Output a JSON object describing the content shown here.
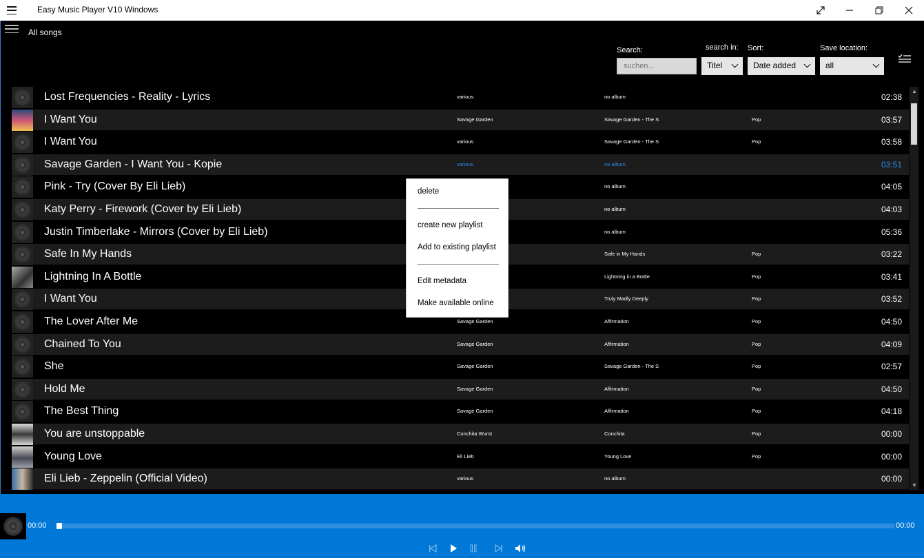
{
  "window": {
    "title": "Easy Music Player V10 Windows"
  },
  "nav": {
    "title": "All songs"
  },
  "filters": {
    "search_label": "Search:",
    "search_placeholder": "suchen...",
    "search_in_label": "search in:",
    "search_in_value": "Titel",
    "sort_label": "Sort:",
    "sort_value": "Date added",
    "save_location_label": "Save location:",
    "save_location_value": "all"
  },
  "songs": [
    {
      "title": "Lost Frequencies  - Reality - Lyrics",
      "artist": "various",
      "album": "no album",
      "genre": "",
      "duration": "02:38",
      "art": "disc"
    },
    {
      "title": "I Want You",
      "artist": "Savage Garden",
      "album": "Savage Garden - The S",
      "genre": "Pop",
      "duration": "03:57",
      "art": "art1"
    },
    {
      "title": "I Want You",
      "artist": "various",
      "album": "Savage Garden - The S",
      "genre": "Pop",
      "duration": "03:58",
      "art": "disc"
    },
    {
      "title": "Savage Garden - I Want You - Kopie",
      "artist": "various",
      "album": "no album",
      "genre": "",
      "duration": "03:51",
      "art": "disc",
      "highlighted": true
    },
    {
      "title": "Pink - Try (Cover By Eli Lieb)",
      "artist": "",
      "album": "no album",
      "genre": "",
      "duration": "04:05",
      "art": "disc"
    },
    {
      "title": "Katy Perry - Firework (Cover by Eli Lieb)",
      "artist": "",
      "album": "no album",
      "genre": "",
      "duration": "04:03",
      "art": "disc"
    },
    {
      "title": "Justin Timberlake - Mirrors (Cover by Eli Lieb)",
      "artist": "",
      "album": "no album",
      "genre": "",
      "duration": "05:36",
      "art": "disc"
    },
    {
      "title": "Safe In My Hands",
      "artist": "",
      "album": "Safe in My Hands",
      "genre": "Pop",
      "duration": "03:22",
      "art": "disc"
    },
    {
      "title": "Lightning In A Bottle",
      "artist": "",
      "album": "Lightning in a Bottle",
      "genre": "Pop",
      "duration": "03:41",
      "art": "art2"
    },
    {
      "title": "I Want You",
      "artist": "",
      "album": "Truly Madly Deeply",
      "genre": "Pop",
      "duration": "03:52",
      "art": "disc"
    },
    {
      "title": "The Lover After Me",
      "artist": "Savage Garden",
      "album": "Affirmation",
      "genre": "Pop",
      "duration": "04:50",
      "art": "disc"
    },
    {
      "title": "Chained To You",
      "artist": "Savage Garden",
      "album": "Affirmation",
      "genre": "Pop",
      "duration": "04:09",
      "art": "disc"
    },
    {
      "title": "She",
      "artist": "Savage Garden",
      "album": "Savage Garden - The S",
      "genre": "Pop",
      "duration": "02:57",
      "art": "disc"
    },
    {
      "title": "Hold Me",
      "artist": "Savage Garden",
      "album": "Affirmation",
      "genre": "Pop",
      "duration": "04:50",
      "art": "disc"
    },
    {
      "title": "The Best Thing",
      "artist": "Savage Garden",
      "album": "Affirmation",
      "genre": "Pop",
      "duration": "04:18",
      "art": "disc"
    },
    {
      "title": "You are unstoppable",
      "artist": "Conchita Wurst",
      "album": "Conchita",
      "genre": "Pop",
      "duration": "00:00",
      "art": "art3"
    },
    {
      "title": "Young Love",
      "artist": "Eli Lieb",
      "album": "Young Love",
      "genre": "Pop",
      "duration": "00:00",
      "art": "art4"
    },
    {
      "title": "Eli Lieb - Zeppelin (Official Video)",
      "artist": "various",
      "album": "no album",
      "genre": "",
      "duration": "00:00",
      "art": "art5"
    }
  ],
  "context_menu": {
    "delete": "delete",
    "create_playlist": "create new playlist",
    "add_existing": "Add to existing playlist",
    "edit_metadata": "Edit metadata",
    "make_online": "Make available online"
  },
  "player": {
    "elapsed": "00:00",
    "total": "00:00",
    "progress": 0
  },
  "colors": {
    "accent": "#0078d7",
    "highlight_text": "#2f8ae8",
    "alt_row": "#1c1c1c"
  }
}
